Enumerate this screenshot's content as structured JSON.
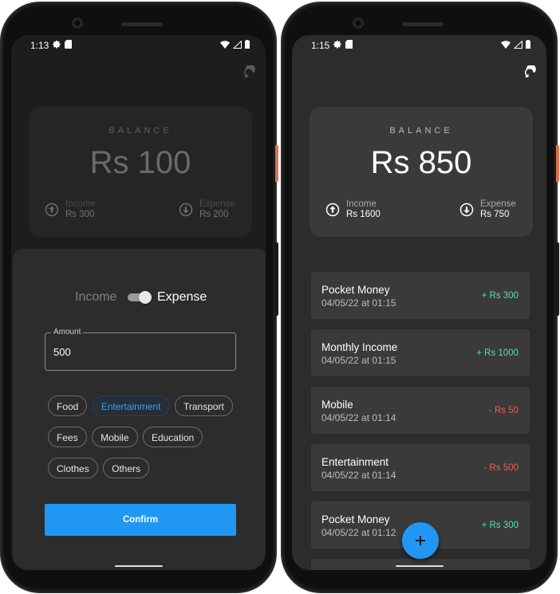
{
  "left_screen": {
    "status": {
      "time": "1:13"
    },
    "balance": {
      "label": "BALANCE",
      "amount": "Rs 100",
      "income_label": "Income",
      "income_value": "Rs 300",
      "expense_label": "Expense",
      "expense_value": "Rs 200"
    },
    "sheet": {
      "toggle_income": "Income",
      "toggle_expense": "Expense",
      "amount_label": "Amount",
      "amount_value": "500",
      "categories": [
        "Food",
        "Entertainment",
        "Transport",
        "Fees",
        "Mobile",
        "Education",
        "Clothes",
        "Others"
      ],
      "selected_category": "Entertainment",
      "confirm_label": "Confirm"
    }
  },
  "right_screen": {
    "status": {
      "time": "1:15"
    },
    "balance": {
      "label": "BALANCE",
      "amount": "Rs 850",
      "income_label": "Income",
      "income_value": "Rs 1600",
      "expense_label": "Expense",
      "expense_value": "Rs 750"
    },
    "transactions": [
      {
        "title": "Pocket Money",
        "time": "04/05/22 at 01:15",
        "amount": "+ Rs 300",
        "type": "income"
      },
      {
        "title": "Monthly Income",
        "time": "04/05/22 at 01:15",
        "amount": "+ Rs 1000",
        "type": "income"
      },
      {
        "title": "Mobile",
        "time": "04/05/22 at 01:14",
        "amount": "- Rs 50",
        "type": "expense"
      },
      {
        "title": "Entertainment",
        "time": "04/05/22 at 01:14",
        "amount": "- Rs 500",
        "type": "expense"
      },
      {
        "title": "Pocket Money",
        "time": "04/05/22 at 01:12",
        "amount": "+ Rs 300",
        "type": "income"
      }
    ],
    "fab_icon": "plus-icon"
  },
  "colors": {
    "accent": "#2196f3",
    "income_green": "#4fe3a0",
    "expense_red": "#f05a5a",
    "card": "#3a3a3a",
    "background": "#2c2c2c"
  }
}
